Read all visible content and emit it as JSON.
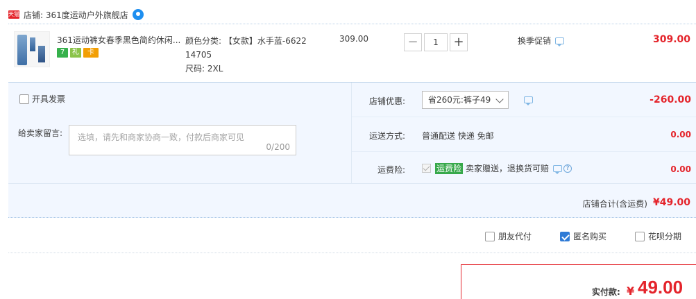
{
  "shop": {
    "badge_text": "天猫",
    "label": "店铺: 361度运动户外旗舰店"
  },
  "item": {
    "title": "361运动裤女春季黑色简约休闲...",
    "sku_color": "颜色分类: 【女款】水手蓝-6622",
    "sku_code": "14705",
    "sku_size": "尺码: 2XL",
    "unit_price": "309.00",
    "quantity": "1",
    "qty_minus": "−",
    "qty_plus": "+",
    "promo": "换季促销",
    "total": "309.00",
    "badges": [
      "7",
      "礼",
      "卡"
    ]
  },
  "panel": {
    "invoice_label": "开具发票",
    "memo_label": "给卖家留言:",
    "memo_placeholder": "选填，请先和商家协商一致，付款后商家可见",
    "memo_count": "0/200",
    "discount_label": "店铺优惠:",
    "discount_value": "省260元:裤子49",
    "discount_amount": "-260.00",
    "shipping_label": "运送方式:",
    "shipping_value": "普通配送 快递 免邮",
    "shipping_amount": "0.00",
    "insurance_label": "运费险:",
    "insurance_tag": "运费险",
    "insurance_text": "卖家赠送，退换货可赔",
    "insurance_amount": "0.00",
    "help_glyph": "?",
    "shop_total_label": "店铺合计(含运费)",
    "shop_total_value": "¥49.00"
  },
  "options": {
    "friend_pay": "朋友代付",
    "anonymous": "匿名购买",
    "huabei": "花呗分期"
  },
  "pay": {
    "label": "实付款:",
    "currency": "¥",
    "value": "49.00"
  },
  "colors": {
    "price_red": "#e4242b",
    "panel_bg": "#f2f7ff",
    "accent_blue": "#2f7bd6",
    "insurance_green": "#36a84a"
  }
}
